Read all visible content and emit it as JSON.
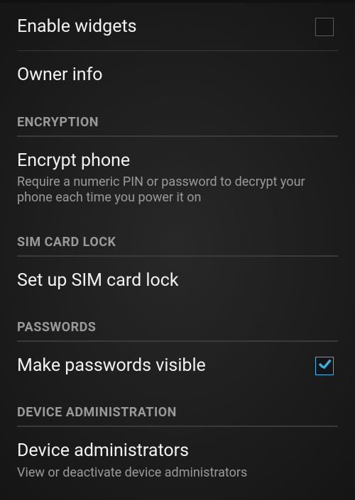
{
  "settings": {
    "enable_widgets": {
      "label": "Enable widgets",
      "checked": false
    },
    "owner_info": {
      "label": "Owner info"
    },
    "sections": {
      "encryption": {
        "header": "ENCRYPTION",
        "encrypt_phone": {
          "label": "Encrypt phone",
          "sub": "Require a numeric PIN or password to decrypt your phone each time you power it on"
        }
      },
      "sim_card_lock": {
        "header": "SIM CARD LOCK",
        "setup": {
          "label": "Set up SIM card lock"
        }
      },
      "passwords": {
        "header": "PASSWORDS",
        "make_visible": {
          "label": "Make passwords visible",
          "checked": true
        }
      },
      "device_admin": {
        "header": "DEVICE ADMINISTRATION",
        "admins": {
          "label": "Device administrators",
          "sub": "View or deactivate device administrators"
        }
      }
    }
  }
}
